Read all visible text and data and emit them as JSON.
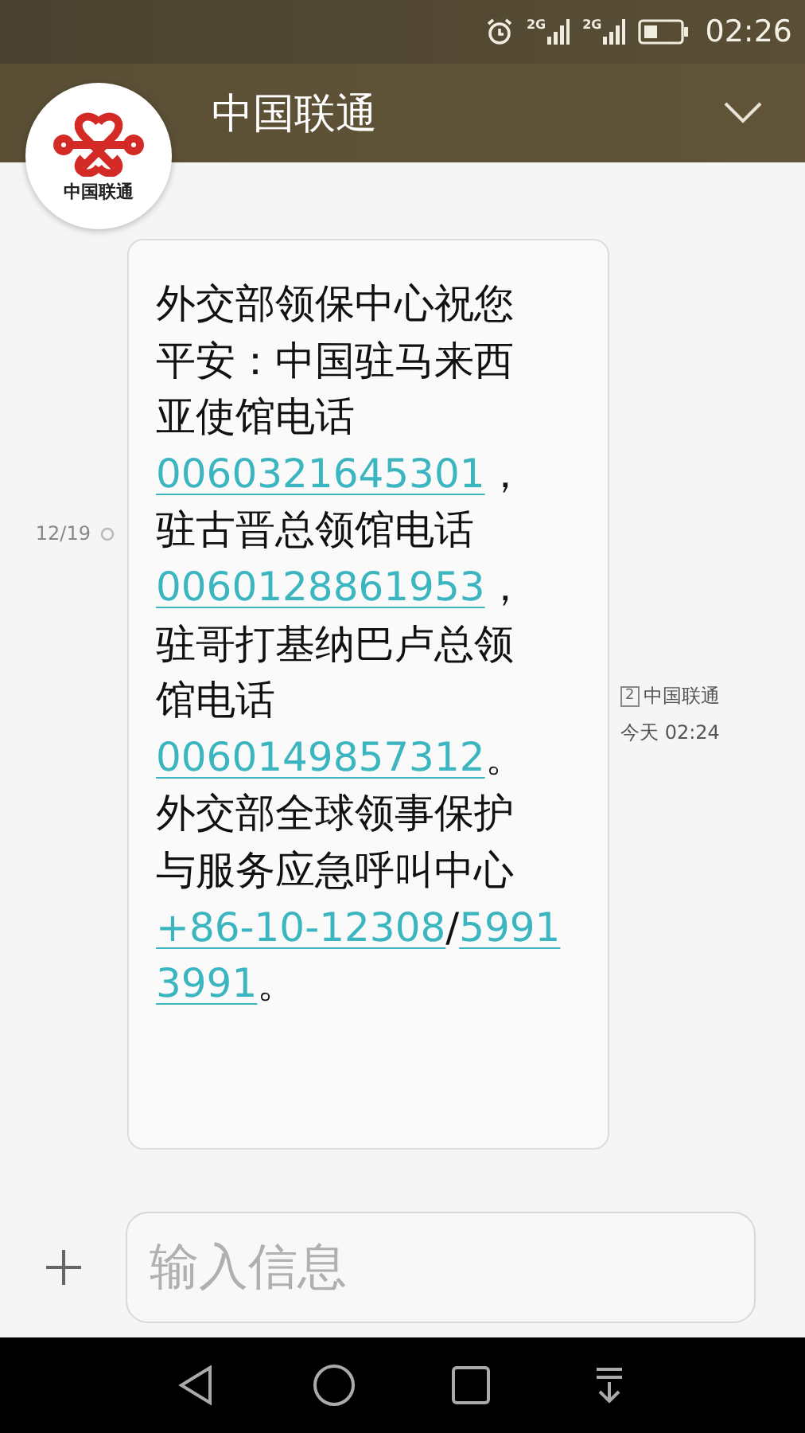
{
  "status_bar": {
    "signals": [
      {
        "label": "2G"
      },
      {
        "label": "2G"
      }
    ],
    "time": "02:26"
  },
  "header": {
    "title": "中国联通",
    "avatar_label": "中国联通"
  },
  "message": {
    "date": "12/19",
    "sim": "2",
    "sender": "中国联通",
    "time": "今天 02:24",
    "lines": [
      [
        {
          "kind": "text",
          "text": "外交部领保中心祝您"
        }
      ],
      [
        {
          "kind": "text",
          "text": "平安：中国驻马来西"
        }
      ],
      [
        {
          "kind": "text",
          "text": "亚使馆电话"
        }
      ],
      [
        {
          "kind": "link",
          "text": "0060321645301"
        },
        {
          "kind": "text",
          "text": "，"
        }
      ],
      [
        {
          "kind": "text",
          "text": "驻古晋总领馆电话"
        }
      ],
      [
        {
          "kind": "link",
          "text": "0060128861953"
        },
        {
          "kind": "text",
          "text": "，"
        }
      ],
      [
        {
          "kind": "text",
          "text": "驻哥打基纳巴卢总领"
        }
      ],
      [
        {
          "kind": "text",
          "text": "馆电话"
        }
      ],
      [
        {
          "kind": "link",
          "text": "0060149857312"
        },
        {
          "kind": "text",
          "text": "。"
        }
      ],
      [
        {
          "kind": "text",
          "text": "外交部全球领事保护"
        }
      ],
      [
        {
          "kind": "text",
          "text": "与服务应急呼叫中心"
        }
      ],
      [
        {
          "kind": "link",
          "text": "+86-10-12308"
        },
        {
          "kind": "text",
          "text": "/"
        },
        {
          "kind": "link",
          "text": "5991"
        }
      ],
      [
        {
          "kind": "link",
          "text": "3991"
        },
        {
          "kind": "text",
          "text": "。"
        }
      ]
    ]
  },
  "composer": {
    "placeholder": "输入信息"
  }
}
